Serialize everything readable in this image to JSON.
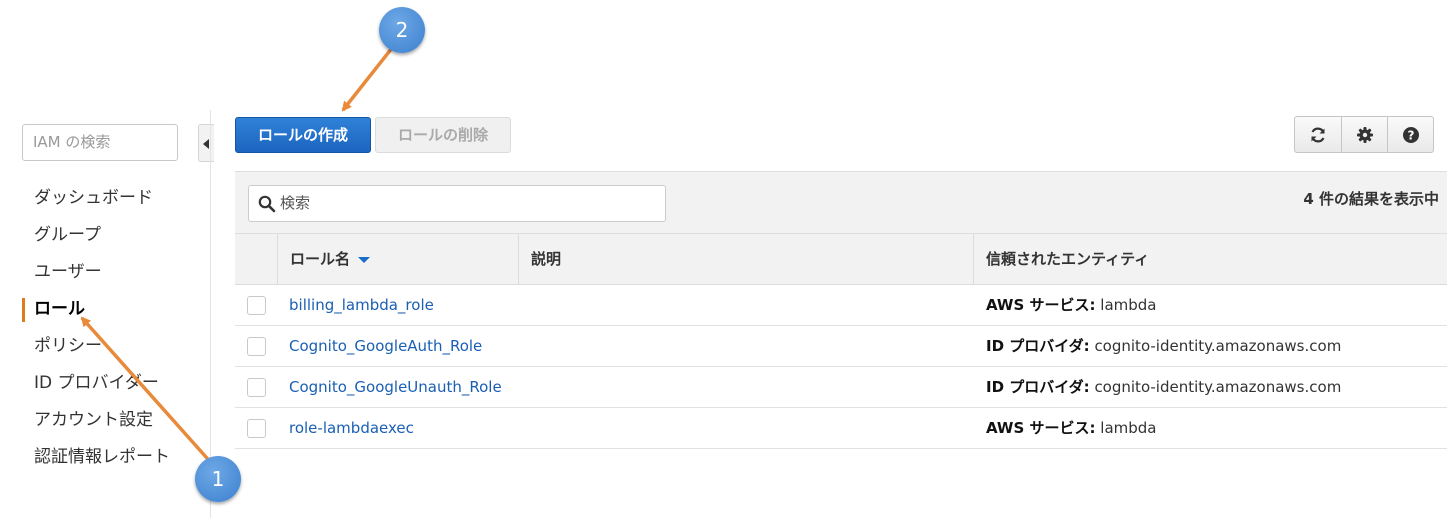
{
  "sidebar": {
    "search_placeholder": "IAM の検索",
    "items": [
      {
        "label": "ダッシュボード"
      },
      {
        "label": "グループ"
      },
      {
        "label": "ユーザー"
      },
      {
        "label": "ロール",
        "active": true
      },
      {
        "label": "ポリシー"
      },
      {
        "label": "ID プロバイダー"
      },
      {
        "label": "アカウント設定"
      },
      {
        "label": "認証情報レポート"
      }
    ]
  },
  "toolbar": {
    "create_label": "ロールの作成",
    "delete_label": "ロールの削除",
    "icons": [
      "refresh-icon",
      "gear-icon",
      "help-icon"
    ]
  },
  "filter": {
    "placeholder": "検索",
    "result_count": "4 件の結果を表示中"
  },
  "table": {
    "columns": [
      "ロール名",
      "説明",
      "信頼されたエンティティ"
    ],
    "rows": [
      {
        "name": "billing_lambda_role",
        "description": "",
        "trust_label": "AWS サービス:",
        "trust_value": "lambda"
      },
      {
        "name": "Cognito_GoogleAuth_Role",
        "description": "",
        "trust_label": "ID プロバイダ:",
        "trust_value": "cognito-identity.amazonaws.com"
      },
      {
        "name": "Cognito_GoogleUnauth_Role",
        "description": "",
        "trust_label": "ID プロバイダ:",
        "trust_value": "cognito-identity.amazonaws.com"
      },
      {
        "name": "role-lambdaexec",
        "description": "",
        "trust_label": "AWS サービス:",
        "trust_value": "lambda"
      }
    ]
  },
  "annotations": {
    "badge1": "1",
    "badge2": "2",
    "arrow_color": "#e88a3a",
    "badge_color": "#4a8fdc"
  }
}
